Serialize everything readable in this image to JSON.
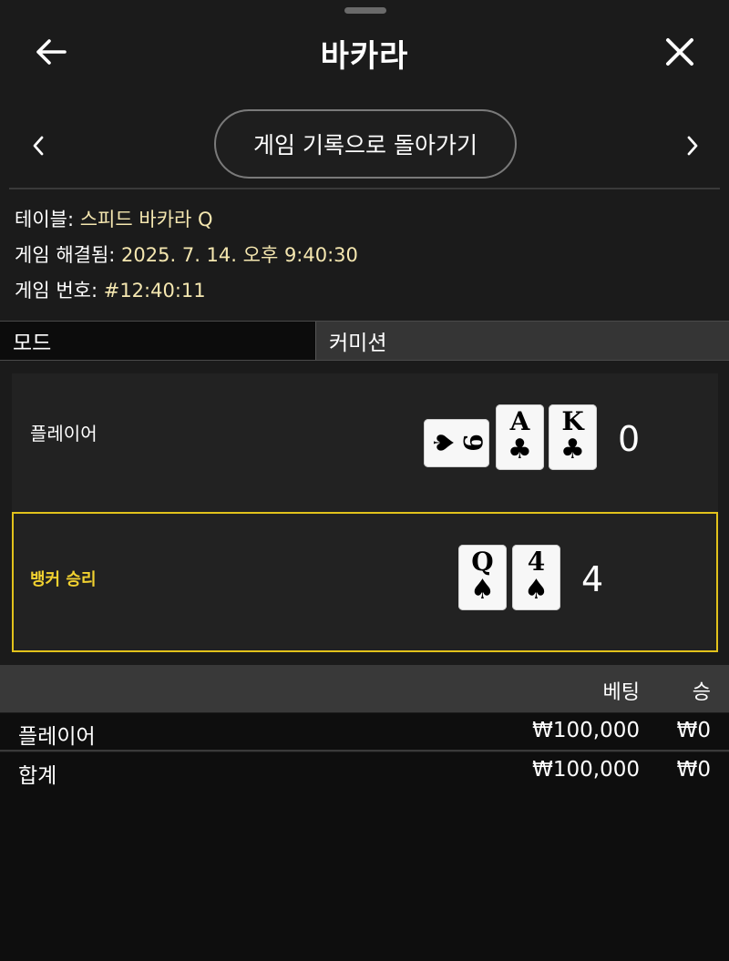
{
  "header": {
    "title": "바카라",
    "back_icon": "arrow-left-icon",
    "close_icon": "close-icon"
  },
  "nav": {
    "history_button_label": "게임 기록으로 돌아가기",
    "prev_icon": "chevron-left-icon",
    "next_icon": "chevron-right-icon"
  },
  "info": {
    "table_label": "테이블:",
    "table_value": "스피드 바카라 Q",
    "resolved_label": "게임 해결됨:",
    "resolved_value": "2025. 7. 14. 오후 9:40:30",
    "game_no_label": "게임 번호:",
    "game_no_value": "#12:40:11"
  },
  "mode": {
    "label": "모드",
    "value": "커미션"
  },
  "hands": {
    "player": {
      "label": "플레이어",
      "score": "0",
      "cards": [
        {
          "rank": "9",
          "suit": "♠",
          "rotated": true
        },
        {
          "rank": "A",
          "suit": "♣",
          "rotated": false
        },
        {
          "rank": "K",
          "suit": "♣",
          "rotated": false
        }
      ]
    },
    "banker": {
      "label": "뱅커 승리",
      "score": "4",
      "cards": [
        {
          "rank": "Q",
          "suit": "♠",
          "rotated": false
        },
        {
          "rank": "4",
          "suit": "♠",
          "rotated": false
        }
      ]
    }
  },
  "bets": {
    "headers": {
      "bet": "베팅",
      "win": "승"
    },
    "rows": [
      {
        "label": "플레이어",
        "bet": "₩100,000",
        "win": "₩0"
      },
      {
        "label": "합계",
        "bet": "₩100,000",
        "win": "₩0"
      }
    ]
  },
  "colors": {
    "background": "#1b1b1b",
    "info_value": "#f5e7b0",
    "banker_highlight": "#e2c21b"
  }
}
